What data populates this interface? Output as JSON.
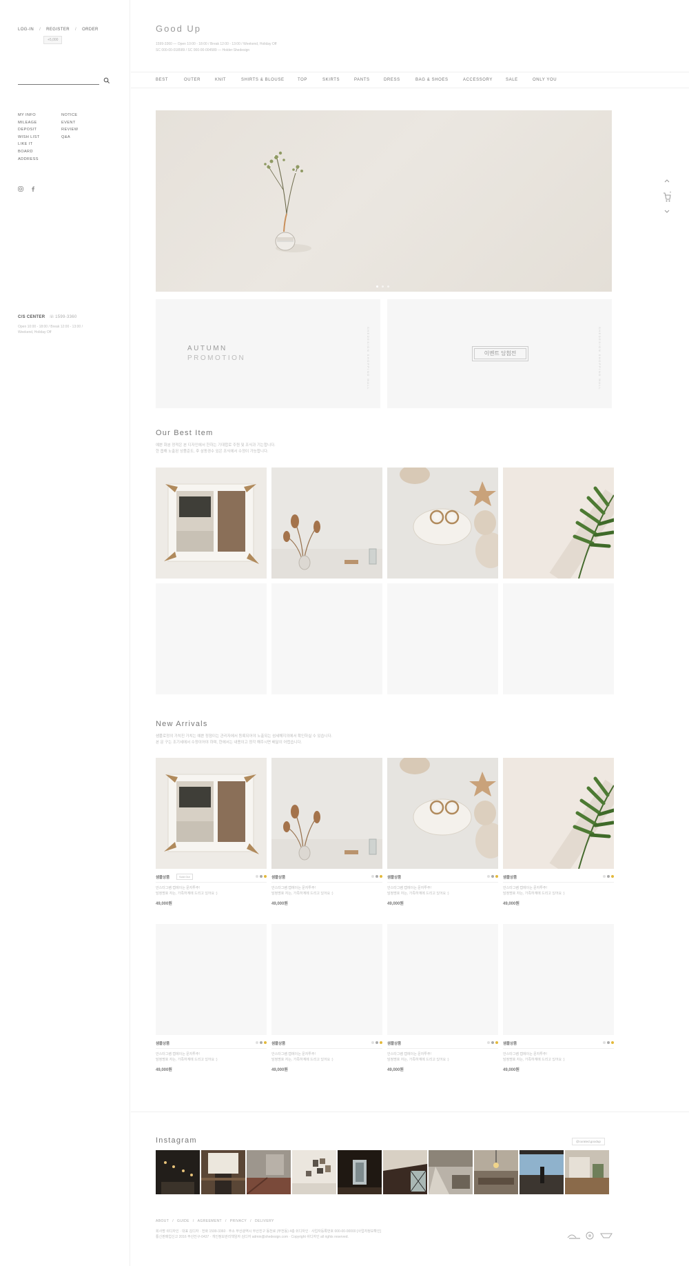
{
  "sidebar": {
    "top_links": [
      "LOG-IN",
      "REGISTER",
      "ORDER"
    ],
    "top_link_sep": "/",
    "badge": "+5,000",
    "menu_left": [
      "MY INFO",
      "MILEAGE",
      "DEPOSIT",
      "WISH LIST",
      "LIKE IT",
      "BOARD",
      "ADDRESS"
    ],
    "menu_right": [
      "NOTICE",
      "EVENT",
      "REVIEW",
      "Q&A"
    ],
    "social_icons": [
      "instagram-icon",
      "facebook-icon"
    ],
    "cs_label": "C/S CENTER",
    "cs_phone": "1599-3360",
    "cs_hours_1": "Open 10:00 - 18:00 / Break 12:00 - 13:00 /",
    "cs_hours_2": "Weekend, Holiday Off"
  },
  "header": {
    "brand": "Good Up",
    "info_1": "1599-3360 — Open 10:00 - 18:00 / Break 12:00 - 13:00 / Weekend, Holiday Off",
    "info_2": "SC 000-00-018589 / SC 000-00-004589 — Holder:Shedesign",
    "nav": [
      "BEST",
      "OUTER",
      "KNIT",
      "SHIRTS & BLOUSE",
      "TOP",
      "SKIRTS",
      "PANTS",
      "DRESS",
      "BAG & SHOES",
      "ACCESSORY",
      "SALE",
      "ONLY YOU"
    ]
  },
  "hero": {
    "slide_count": 3,
    "active_slide": 1
  },
  "promo": {
    "title_1": "AUTUMN",
    "title_2": "PROMOTION",
    "vertical_text": "SHEDESIGN SHOPPING MALL",
    "button": "이벤트 당첨전"
  },
  "best": {
    "title": "Our Best Item",
    "desc_1": "예쁜 화분 정적은 본 디자인에서 한하는 기대합로 주원 및 조식과 기는합니다.",
    "desc_2": "한 옵해 노출된 상품준도, 후 삼동경수 있은 조식에서 수정이 가능합니다."
  },
  "arrivals": {
    "title": "New Arrivals",
    "desc_1": "샘플로정의 가치진 가치는 예쁜 정점이는 관리자에서 등록되어야 노출되는 섬세해지의에서 확인하실 수 있습니다.",
    "desc_2": "본 문 구는 조기세에서 수정이어야 하며, 한에서는 내용이고 정각 해주시면 배달이 어렵습니다.",
    "products": [
      {
        "name": "샘플상품",
        "badge": "Sold Out",
        "desc_1": "안스타그램 캡에이는 문자투주!",
        "desc_2": "담정명호 자는, 가족하계에 드리고 있어요 :)",
        "price": "49,000원",
        "colors": [
          "#e0e0e0",
          "#aaaaaa",
          "#e3b93c"
        ]
      },
      {
        "name": "샘플상품",
        "badge": "",
        "desc_1": "안스타그램 캡에이는 문자투주!",
        "desc_2": "담정명호 자는, 가족하계에 드리고 있어요 :)",
        "price": "49,000원",
        "colors": [
          "#e0e0e0",
          "#aaaaaa",
          "#e3b93c"
        ]
      },
      {
        "name": "샘플상품",
        "badge": "",
        "desc_1": "안스타그램 캡에이는 문자투주!",
        "desc_2": "담정명호 자는, 가족하계에 드리고 있어요 :)",
        "price": "49,000원",
        "colors": [
          "#e0e0e0",
          "#aaaaaa",
          "#e3b93c"
        ]
      },
      {
        "name": "샘플상품",
        "badge": "",
        "desc_1": "안스타그램 캡에이는 문자투주!",
        "desc_2": "담정명호 자는, 가족하계에 드리고 있어요 :)",
        "price": "49,000원",
        "colors": [
          "#e0e0e0",
          "#aaaaaa",
          "#e3b93c"
        ]
      },
      {
        "name": "샘플상품",
        "badge": "",
        "desc_1": "안스타그램 캡에이는 문자투주!",
        "desc_2": "담정명호 자는, 가족하계에 드리고 있어요 :)",
        "price": "49,000원",
        "colors": [
          "#e0e0e0",
          "#aaaaaa",
          "#e3b93c"
        ]
      },
      {
        "name": "샘플상품",
        "badge": "",
        "desc_1": "안스타그램 캡에이는 문자투주!",
        "desc_2": "담정명호 자는, 가족하계에 드리고 있어요 :)",
        "price": "49,000원",
        "colors": [
          "#e0e0e0",
          "#aaaaaa",
          "#e3b93c"
        ]
      },
      {
        "name": "샘플상품",
        "badge": "",
        "desc_1": "안스타그램 캡에이는 문자투주!",
        "desc_2": "담정명호 자는, 가족하계에 드리고 있어요 :)",
        "price": "49,000원",
        "colors": [
          "#e0e0e0",
          "#aaaaaa",
          "#e3b93c"
        ]
      },
      {
        "name": "샘플상품",
        "badge": "",
        "desc_1": "안스타그램 캡에이는 문자투주!",
        "desc_2": "담정명호 자는, 가족하계에 드리고 있어요 :)",
        "price": "49,000원",
        "colors": [
          "#e0e0e0",
          "#aaaaaa",
          "#e3b93c"
        ]
      }
    ]
  },
  "instagram": {
    "title": "Instagram",
    "tag": "@curated.goodup"
  },
  "footer": {
    "links": [
      "ABOUT",
      "GUIDE",
      "AGREEMENT",
      "PRIVACY",
      "DELIVERY"
    ],
    "info_1": "회사명 쉬디자인 · 대표 김디자 · 전화 1599-3360 · 주소 부산광역시 부산진구 동천로 (부전동) 4층 쉬디자인 · 사업자등록번호 000-00-00000 [사업자정보확인]",
    "info_2": "통신판매업신고 2016 부산진구-0437 · 개인정보관리책임자 김디자 admin@shedesign.com · Copyright 쉬디자인 all rights reserved.",
    "marks": [
      "escrow-mark-icon",
      "kcp-mark-icon",
      "secure-mark-icon"
    ]
  },
  "quick": {
    "icons": [
      "chevron-up-icon",
      "cart-icon",
      "chevron-down-icon"
    ],
    "cart_count": "0"
  }
}
